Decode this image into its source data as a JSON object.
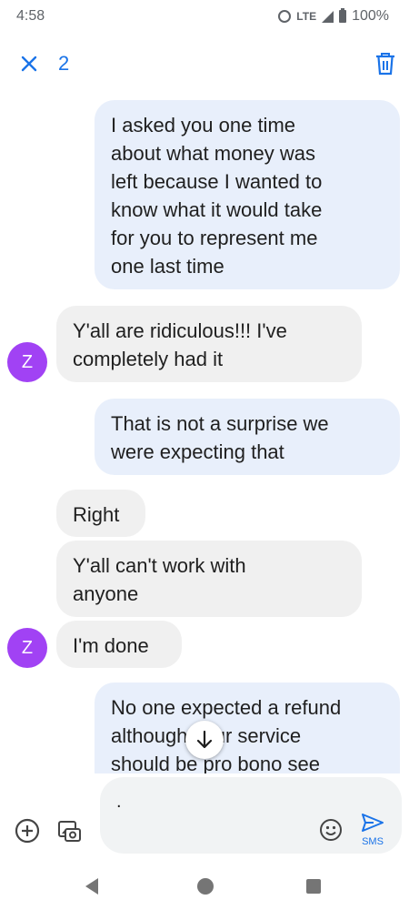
{
  "status_bar": {
    "time": "4:58",
    "network": "LTE",
    "battery": "100%"
  },
  "action_bar": {
    "selected_count": "2",
    "icons": [
      "close-icon",
      "delete-icon"
    ]
  },
  "colors": {
    "accent": "#1a73e8",
    "avatar": "#a142f4",
    "outgoing_bubble": "#e8effb",
    "incoming_bubble": "#f0f0f0"
  },
  "messages": [
    {
      "direction": "outgoing",
      "text": "I asked you one time\nabout what money was\nleft because I wanted to\nknow what it would take\nfor you to represent me\none last time"
    },
    {
      "direction": "incoming",
      "text": "Y'all are ridiculous!!! I've\ncompletely had it",
      "avatar": "Z"
    },
    {
      "direction": "outgoing",
      "text": "That is not a surprise we\nwere expecting that"
    },
    {
      "direction": "incoming",
      "text": "Right"
    },
    {
      "direction": "incoming",
      "text": "Y'all can't work with\nanyone"
    },
    {
      "direction": "incoming",
      "text": "I'm done",
      "avatar": "Z"
    },
    {
      "direction": "outgoing",
      "text": "No one expected a refund\nalthough your service\nshould be pro bono see"
    }
  ],
  "compose": {
    "value": ".",
    "send_label": "SMS"
  }
}
